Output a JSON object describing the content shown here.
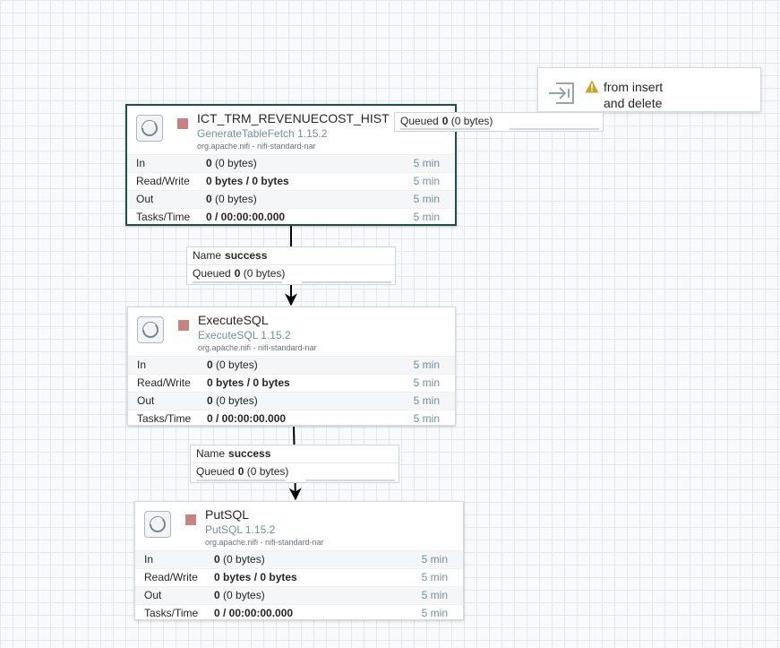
{
  "processors": [
    {
      "name": "ICT_TRM_REVENUECOST_HIST",
      "type": "GenerateTableFetch 1.15.2",
      "bundle": "org.apache.nifi - nifi-standard-nar",
      "stats": {
        "in_label": "In",
        "in_value": "0",
        "in_detail": "(0 bytes)",
        "in_time": "5 min",
        "rw_label": "Read/Write",
        "rw_value": "0 bytes / 0 bytes",
        "rw_time": "5 min",
        "out_label": "Out",
        "out_value": "0",
        "out_detail": "(0 bytes)",
        "out_time": "5 min",
        "tasks_label": "Tasks/Time",
        "tasks_value": "0 / 00:00:00.000",
        "tasks_time": "5 min"
      }
    },
    {
      "name": "ExecuteSQL",
      "type": "ExecuteSQL 1.15.2",
      "bundle": "org.apache.nifi - nifi-standard-nar",
      "stats": {
        "in_label": "In",
        "in_value": "0",
        "in_detail": "(0 bytes)",
        "in_time": "5 min",
        "rw_label": "Read/Write",
        "rw_value": "0 bytes / 0 bytes",
        "rw_time": "5 min",
        "out_label": "Out",
        "out_value": "0",
        "out_detail": "(0 bytes)",
        "out_time": "5 min",
        "tasks_label": "Tasks/Time",
        "tasks_value": "0 / 00:00:00.000",
        "tasks_time": "5 min"
      }
    },
    {
      "name": "PutSQL",
      "type": "PutSQL 1.15.2",
      "bundle": "org.apache.nifi - nifi-standard-nar",
      "stats": {
        "in_label": "In",
        "in_value": "0",
        "in_detail": "(0 bytes)",
        "in_time": "5 min",
        "rw_label": "Read/Write",
        "rw_value": "0 bytes / 0 bytes",
        "rw_time": "5 min",
        "out_label": "Out",
        "out_value": "0",
        "out_detail": "(0 bytes)",
        "out_time": "5 min",
        "tasks_label": "Tasks/Time",
        "tasks_value": "0 / 00:00:00.000",
        "tasks_time": "5 min"
      }
    }
  ],
  "connections": [
    {
      "name_label": "Name",
      "name_value": "success",
      "queued_label": "Queued",
      "queued_value": "0",
      "queued_detail": "(0 bytes)"
    },
    {
      "name_label": "Name",
      "name_value": "success",
      "queued_label": "Queued",
      "queued_value": "0",
      "queued_detail": "(0 bytes)"
    },
    {
      "queued_label": "Queued",
      "queued_value": "0",
      "queued_detail": "(0 bytes)"
    }
  ],
  "input_port": {
    "name_line1": "from insert",
    "name_line2": "and delete",
    "icon": "input-port-icon",
    "status_icon": "warning-icon"
  },
  "colors": {
    "run_state_stopped": "#c98282",
    "selected_border": "#1e4f4a",
    "warning": "#c9a227",
    "type_text": "#728e9b"
  }
}
